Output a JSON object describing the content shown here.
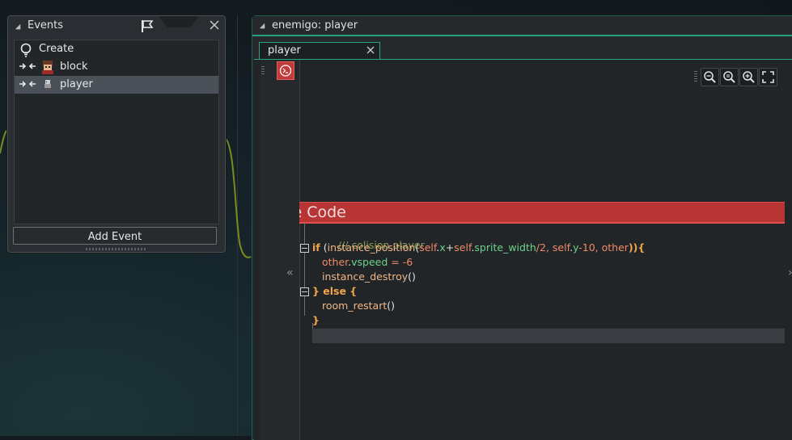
{
  "events_panel": {
    "title": "Events",
    "items": [
      {
        "label": "Create",
        "icon": "lightbulb-icon",
        "selected": false
      },
      {
        "label": "block",
        "icon": "collision-icon",
        "sprite": "block-sprite",
        "selected": false
      },
      {
        "label": "player",
        "icon": "collision-icon",
        "sprite": "player-sprite",
        "selected": true
      }
    ],
    "add_event_label": "Add Event"
  },
  "editor": {
    "title": "enemigo: player",
    "tab_label": "player",
    "action_header": "Execute Code",
    "action_header_visible": "ute Code",
    "code": {
      "line1": "/// colision player",
      "line2_if": "if",
      "line2_a": "(",
      "line2_fn": "instance_position",
      "line2_b": "(",
      "line2_self1": "self",
      "line2_dot1": ".",
      "line2_x": "x",
      "line2_plus": "+",
      "line2_self2": "self",
      "line2_dot2": ".",
      "line2_sw": "sprite_width",
      "line2_div": "/2, ",
      "line2_self3": "self",
      "line2_dot3": ".",
      "line2_y": "y",
      "line2_m10": "-10, ",
      "line2_other": "other",
      "line2_end": ")){",
      "line3_other": "other",
      "line3_dot": ".",
      "line3_vspeed": "vspeed",
      "line3_rest": " = -6",
      "line4_fn": "instance_destroy",
      "line4_paren": "()",
      "line5": "} else {",
      "line6_fn": "room_restart",
      "line6_paren": "()",
      "line7": "}"
    }
  },
  "colors": {
    "accent": "#26a07c",
    "action_header": "#b73535",
    "keyword": "#f2a54a",
    "builtin_var": "#6bd48a",
    "comment": "#8a9a52"
  }
}
